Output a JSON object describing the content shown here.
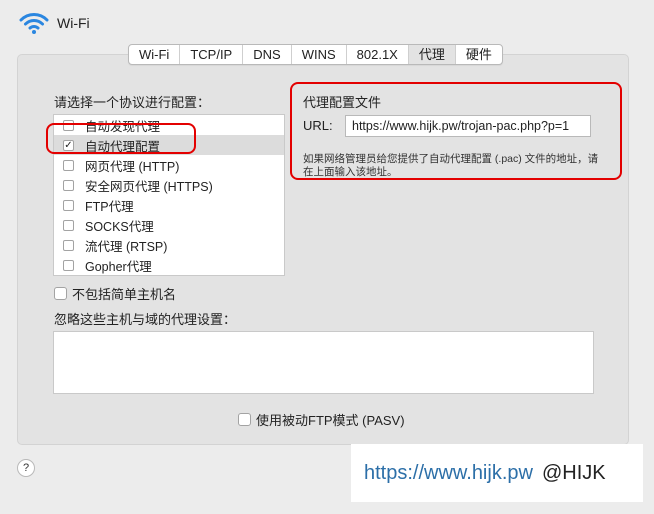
{
  "header": {
    "title": "Wi-Fi",
    "icon": "wifi-icon"
  },
  "tabs": [
    {
      "label": "Wi-Fi",
      "active": false
    },
    {
      "label": "TCP/IP",
      "active": false
    },
    {
      "label": "DNS",
      "active": false
    },
    {
      "label": "WINS",
      "active": false
    },
    {
      "label": "802.1X",
      "active": false
    },
    {
      "label": "代理",
      "active": true
    },
    {
      "label": "硬件",
      "active": false
    }
  ],
  "protocols": {
    "heading": "请选择一个协议进行配置：",
    "items": [
      {
        "label": "自动发现代理",
        "checked": false,
        "selected": false
      },
      {
        "label": "自动代理配置",
        "checked": true,
        "selected": true
      },
      {
        "label": "网页代理 (HTTP)",
        "checked": false,
        "selected": false
      },
      {
        "label": "安全网页代理 (HTTPS)",
        "checked": false,
        "selected": false
      },
      {
        "label": "FTP代理",
        "checked": false,
        "selected": false
      },
      {
        "label": "SOCKS代理",
        "checked": false,
        "selected": false
      },
      {
        "label": "流代理 (RTSP)",
        "checked": false,
        "selected": false
      },
      {
        "label": "Gopher代理",
        "checked": false,
        "selected": false
      }
    ]
  },
  "pac": {
    "heading": "代理配置文件",
    "url_label": "URL:",
    "url_value": "https://www.hijk.pw/trojan-pac.php?p=1",
    "note": "如果网络管理员给您提供了自动代理配置 (.pac) 文件的地址，请在上面输入该地址。"
  },
  "exclude_simple_hosts": {
    "label": "不包括简单主机名",
    "checked": false
  },
  "bypass": {
    "label": "忽略这些主机与域的代理设置：",
    "value": ""
  },
  "pasv": {
    "label": "使用被动FTP模式 (PASV)",
    "checked": false
  },
  "help": {
    "glyph": "?"
  },
  "watermark": {
    "url": "https://www.hijk.pw",
    "handle": "@HIJK"
  },
  "colors": {
    "highlight": "#e30000",
    "watermark_link": "#2c6fa8",
    "panel": "#e3e3e3"
  }
}
